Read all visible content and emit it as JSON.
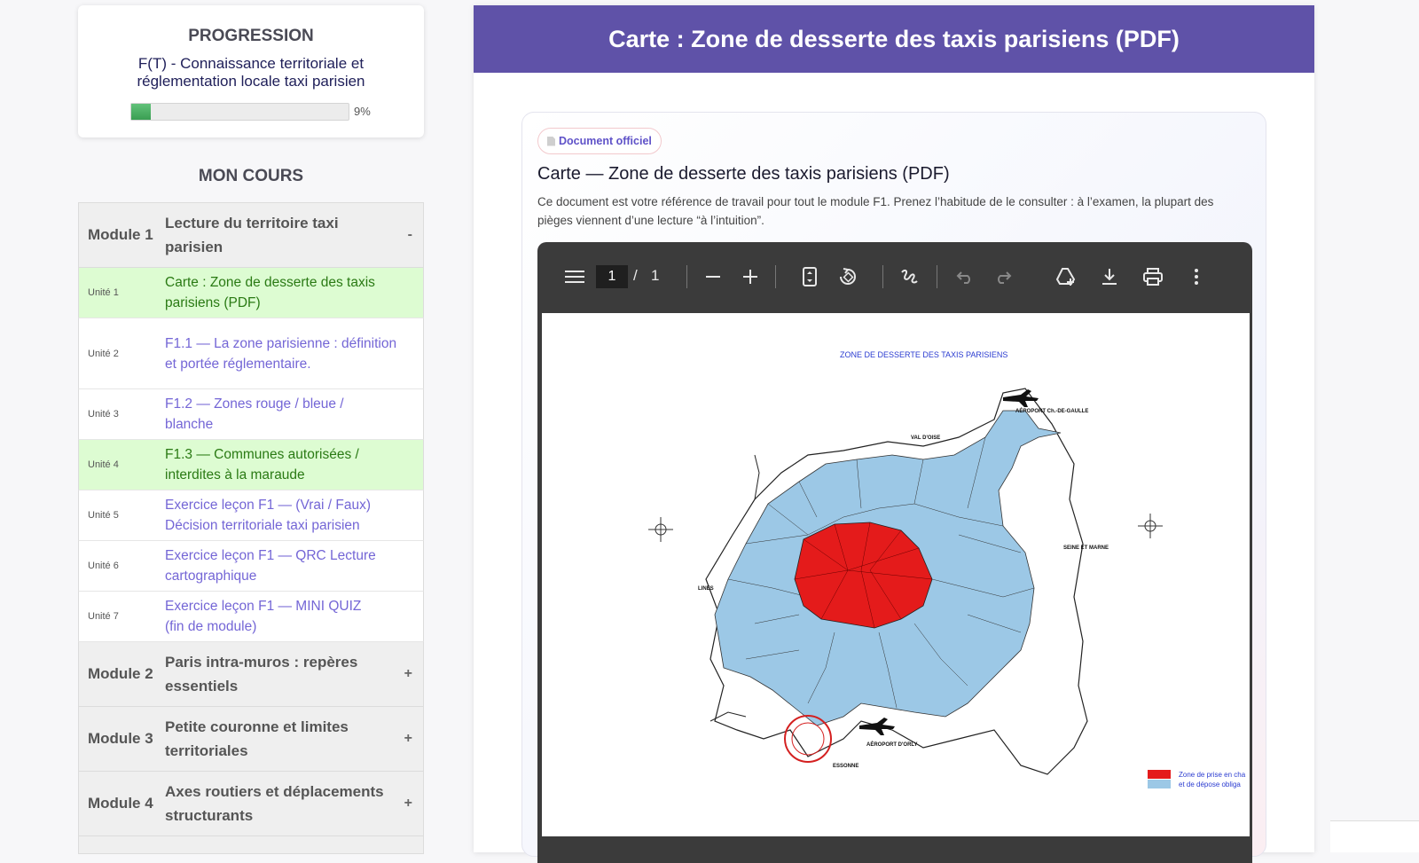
{
  "progress": {
    "heading": "PROGRESSION",
    "course_title": "F(T) - Connaissance territoriale et réglementation locale taxi parisien",
    "percent_label": "9%",
    "percent_value": 9
  },
  "course": {
    "heading": "MON COURS",
    "modules": [
      {
        "num": "Module 1",
        "name": "Lecture du territoire taxi parisien",
        "toggle": "-",
        "units": [
          {
            "num": "Unité 1",
            "name": "Carte : Zone de desserte des taxis parisiens (PDF)",
            "done": true
          },
          {
            "num": "Unité 2",
            "name": "F1.1 — La zone parisienne : définition et portée réglementaire.",
            "done": false
          },
          {
            "num": "Unité 3",
            "name": "F1.2 — Zones rouge / bleue / blanche",
            "done": false
          },
          {
            "num": "Unité 4",
            "name": "F1.3 — Communes autorisées / interdites à la maraude",
            "done": true
          },
          {
            "num": "Unité 5",
            "name": "Exercice leçon F1 — (Vrai / Faux) Décision territoriale taxi parisien",
            "done": false
          },
          {
            "num": "Unité 6",
            "name": "Exercice leçon F1 — QRC Lecture cartographique",
            "done": false
          },
          {
            "num": "Unité 7",
            "name": "Exercice leçon F1 — MINI QUIZ (fin de module)",
            "done": false
          }
        ]
      },
      {
        "num": "Module 2",
        "name": "Paris intra-muros : repères essentiels",
        "toggle": "+"
      },
      {
        "num": "Module 3",
        "name": "Petite couronne et limites territoriales",
        "toggle": "+"
      },
      {
        "num": "Module 4",
        "name": "Axes routiers et déplacements structurants",
        "toggle": "+"
      }
    ]
  },
  "main": {
    "header_title": "Carte : Zone de desserte des taxis parisiens (PDF)",
    "badge": "Document officiel",
    "doc_title": "Carte — Zone de desserte des taxis parisiens (PDF)",
    "doc_desc": "Ce document est votre référence de travail pour tout le module F1. Prenez l’habitude de le consulter : à l’examen, la plupart des pièges viennent d’une lecture “à l’intuition”."
  },
  "pdf": {
    "page_current": "1",
    "page_sep": "/",
    "page_total": "1",
    "map_title": "ZONE DE DESSERTE DES TAXIS PARISIENS",
    "legend_line1": "Zone de prise en cha",
    "legend_line2": "et de dépose obliga",
    "labels": {
      "cdg": "AÉROPORT Ch.-DE-GAULLE",
      "orly": "AÉROPORT D'ORLY",
      "val_oise": "VAL D'OISE",
      "seine_marne": "SEINE ET MARNE",
      "yvelines": "LINES",
      "essonne": "ESSONNE"
    }
  },
  "colors": {
    "header_bg": "#5f52a8",
    "unit_link": "#7466d6",
    "unit_done_bg": "#ddfcd2",
    "zone_red": "#e41b1b",
    "zone_blue": "#9cc8e6"
  }
}
